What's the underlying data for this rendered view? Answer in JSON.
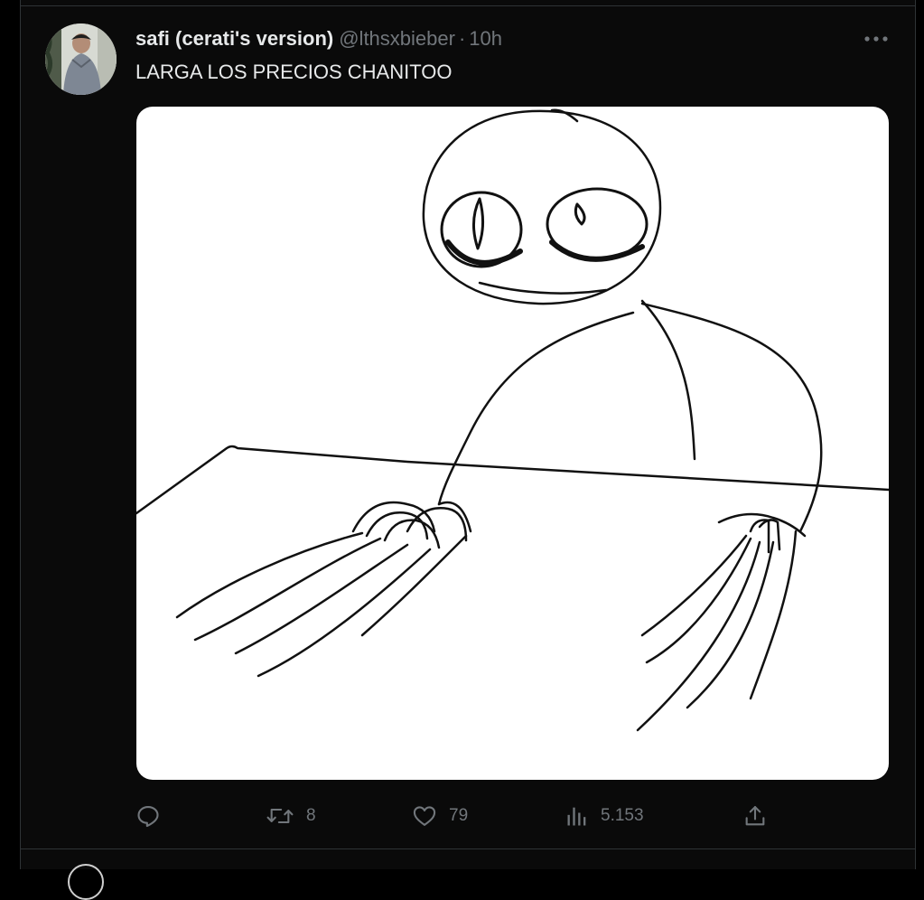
{
  "tweet": {
    "display_name": "safi (cerati's version)",
    "handle": "@lthsxbieber",
    "time": "10h",
    "text": "LARGA LOS PRECIOS CHANITOO"
  },
  "actions": {
    "reply": {
      "icon": "reply-icon"
    },
    "retweet": {
      "icon": "retweet-icon",
      "count": "8"
    },
    "like": {
      "icon": "heart-icon",
      "count": "79"
    },
    "views": {
      "icon": "views-icon",
      "count": "5.153"
    },
    "share": {
      "icon": "share-icon"
    }
  },
  "more_icon": "more-icon",
  "colors": {
    "background": "#000000",
    "column": "#0a0a0a",
    "primary_text": "#e7e9ea",
    "secondary_text": "#71767b",
    "divider": "#2f3336"
  }
}
